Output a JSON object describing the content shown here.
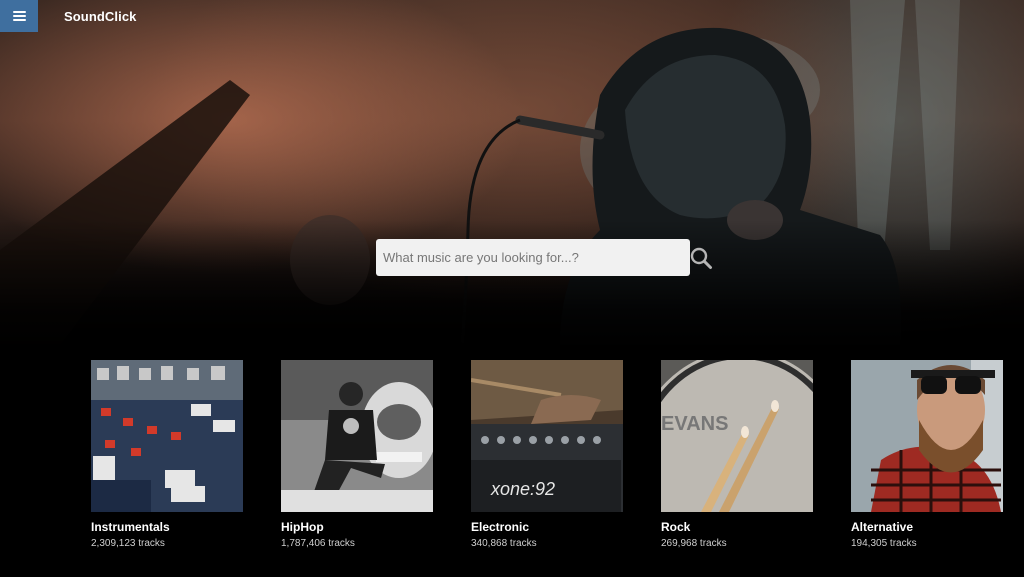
{
  "header": {
    "brand": "SoundClick",
    "menu_icon": "hamburger-menu-icon"
  },
  "search": {
    "placeholder": "What music are you looking for...?",
    "value": "",
    "icon": "search-icon"
  },
  "genres": [
    {
      "name": "Instrumentals",
      "tracks": "2,309,123 tracks"
    },
    {
      "name": "HipHop",
      "tracks": "1,787,406 tracks"
    },
    {
      "name": "Electronic",
      "tracks": "340,868 tracks"
    },
    {
      "name": "Rock",
      "tracks": "269,968 tracks"
    },
    {
      "name": "Alternative",
      "tracks": "194,305 tracks"
    }
  ],
  "colors": {
    "menu_button": "#3f6f9f",
    "background": "#000000",
    "search_box": "#f1f1f1"
  }
}
